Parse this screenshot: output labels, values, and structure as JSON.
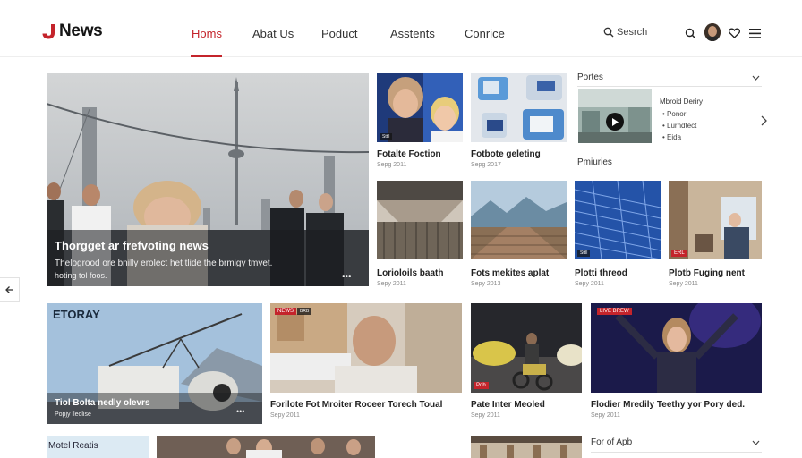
{
  "header": {
    "logo_text": "News",
    "nav": [
      "Homs",
      "Abat Us",
      "Poduct",
      "Asstents",
      "Conrice"
    ],
    "search_label": "Sesrch"
  },
  "hero": {
    "title": "Thorgget ar frefvoting news",
    "line1": "Thelogrood ore bnilly erolect het tlide the brmigy tmyet.",
    "line2": "hoting tol foos."
  },
  "top_cards": [
    {
      "title": "Fotalte Foction",
      "date": "Sepg 2011",
      "tag": "Sttll"
    },
    {
      "title": "Fotbote geleting",
      "date": "Sepg 2017"
    }
  ],
  "right_panel": {
    "section1": "Portes",
    "item_title": "Mbroid Deriry",
    "items": [
      "Ponor",
      "Lurndtect",
      "Eida"
    ],
    "section2": "Pmiuries"
  },
  "mid_cards": [
    {
      "title": "Lorioloils baath",
      "date": "Sepy 2011"
    },
    {
      "title": "Fots mekites aplat",
      "date": "Sepy 2013"
    },
    {
      "title": "Plotti threod",
      "date": "Sepy 2011",
      "tag": "Sttll"
    },
    {
      "title": "Plotb Fuging nent",
      "date": "Sepy 2011",
      "tag": "ERL"
    }
  ],
  "bottom_cards": [
    {
      "label": "ETORAY",
      "title": "Tiol Bolta nedly olevrs",
      "date": "Popjy lleolise"
    },
    {
      "badge": "NEWS",
      "tag": "BRB",
      "title": "Forilote Fot Mroiter Roceer Torech Toual",
      "date": "Sepy 2011"
    },
    {
      "badge": "Pob",
      "title": "Pate Inter Meoled",
      "date": "Sepy 2011"
    },
    {
      "badge": "LIVE BREW",
      "title": "Flodier Mredily Teethy yor Pory ded.",
      "date": "Sepy 2011"
    }
  ],
  "footer_row": {
    "left_label": "Motel Reatis",
    "right_label": "For of Apb"
  },
  "colors": {
    "accent": "#c4242b",
    "text": "#1b1b1b",
    "muted": "#8a8a8a"
  }
}
